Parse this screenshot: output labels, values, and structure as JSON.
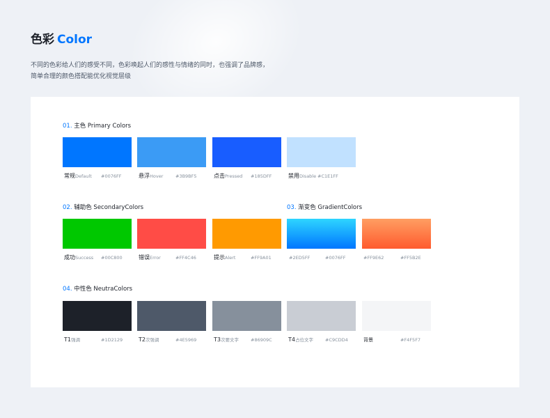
{
  "header": {
    "title_zh": "色彩",
    "title_en": "Color",
    "description": "不同的色彩给人们的感受不同，色彩唤起人们的感性与情绪的同时，也强调了品牌感，简单合理的颜色搭配能优化视觉层级"
  },
  "sections": {
    "primary": {
      "num": "01.",
      "title": "主色 Primary Colors",
      "items": [
        {
          "label": "常规",
          "sub": "Default",
          "hex": "#0076FF",
          "color": "#0076FF"
        },
        {
          "label": "悬浮",
          "sub": "Hover",
          "hex": "#3B9BF5",
          "color": "#3B9BF5"
        },
        {
          "label": "点击",
          "sub": "Pressed",
          "hex": "#185DFF",
          "color": "#185DFF"
        },
        {
          "label": "禁用",
          "sub": "Disable",
          "hex": "#C1E1FF",
          "color": "#C1E1FF"
        }
      ]
    },
    "secondary": {
      "num": "02.",
      "title": "辅助色 SecondaryColors",
      "items": [
        {
          "label": "成功",
          "sub": "Success",
          "hex": "#00C800",
          "color": "#00C800"
        },
        {
          "label": "错误",
          "sub": "Error",
          "hex": "#FF4C46",
          "color": "#FF4C46"
        },
        {
          "label": "提示",
          "sub": "Alert",
          "hex": "#FF9A01",
          "color": "#FF9A01"
        }
      ]
    },
    "gradient": {
      "num": "03.",
      "title": "渐变色 GradientColors",
      "items": [
        {
          "from_hex": "#2ED5FF",
          "to_hex": "#0076FF",
          "from": "#2ED5FF",
          "to": "#0076FF"
        },
        {
          "from_hex": "#FF9E62",
          "to_hex": "#FF5B2E",
          "from": "#FF9E62",
          "to": "#FF5B2E"
        }
      ]
    },
    "neutral": {
      "num": "04.",
      "title": "中性色 NeutraColors",
      "items": [
        {
          "label": "T1",
          "sub": "强调",
          "hex": "#1D2129",
          "color": "#1D2129"
        },
        {
          "label": "T2",
          "sub": "次强调",
          "hex": "#4E5969",
          "color": "#4E5969"
        },
        {
          "label": "T3",
          "sub": "次要文字",
          "hex": "#86909C",
          "color": "#86909C"
        },
        {
          "label": "T4",
          "sub": "占位文字",
          "hex": "#C9CDD4",
          "color": "#C9CDD4"
        },
        {
          "label": "",
          "sub": "背景",
          "hex": "#F4F5F7",
          "color": "#F4F5F7"
        }
      ]
    }
  }
}
